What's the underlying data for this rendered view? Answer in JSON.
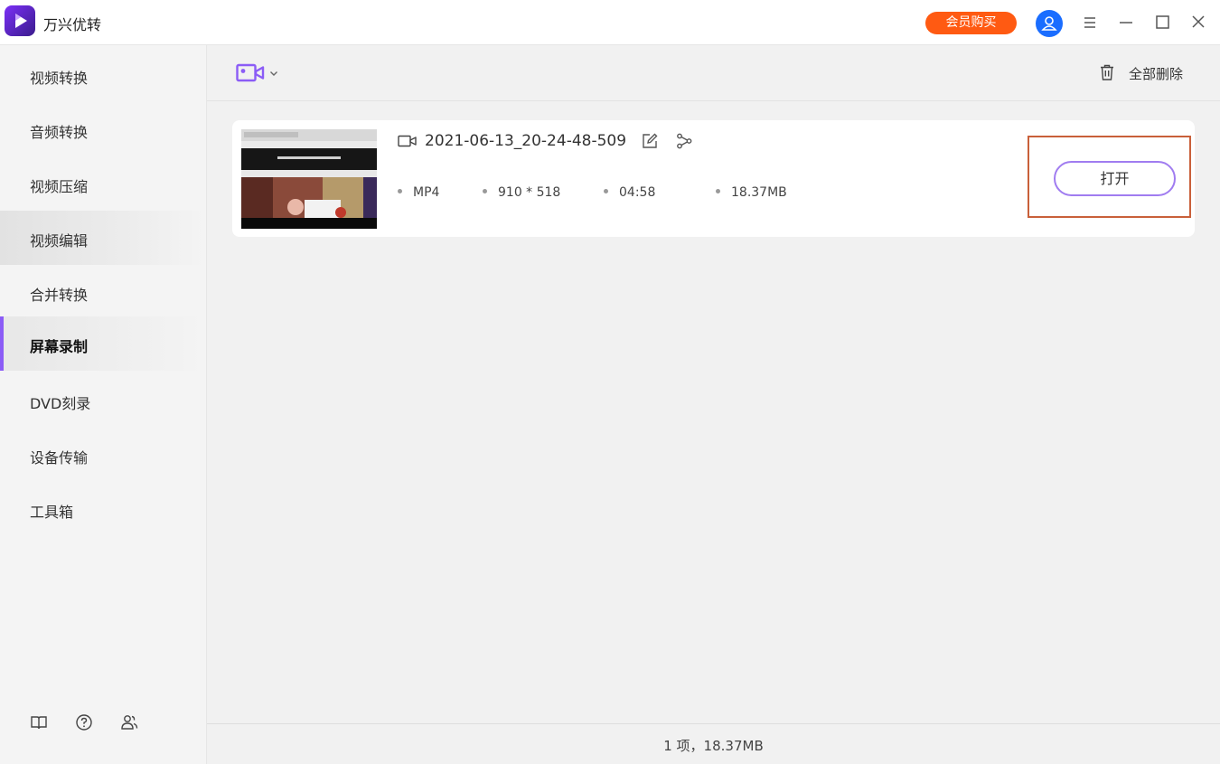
{
  "app": {
    "title": "万兴优转",
    "vip_label": "会员购买",
    "icons": {
      "logo": "app-logo-play-icon",
      "avatar": "user-avatar-icon",
      "menu": "hamburger-menu-icon",
      "minimize": "minimize-icon",
      "maximize": "maximize-icon",
      "close": "close-icon"
    },
    "colors": {
      "vip": "#ff5a12",
      "avatar": "#1a6dff",
      "accent": "#8b5cf6"
    }
  },
  "sidebar": {
    "items": [
      {
        "label": "视频转换",
        "state": "normal"
      },
      {
        "label": "音频转换",
        "state": "normal"
      },
      {
        "label": "视频压缩",
        "state": "normal"
      },
      {
        "label": "视频编辑",
        "state": "hover"
      },
      {
        "label": "合并转换",
        "state": "normal"
      },
      {
        "label": "屏幕录制",
        "state": "active"
      },
      {
        "label": "DVD刻录",
        "state": "normal"
      },
      {
        "label": "设备传输",
        "state": "normal"
      },
      {
        "label": "工具箱",
        "state": "normal"
      }
    ],
    "bottom_icons": [
      "book-guide-icon",
      "help-icon",
      "community-icon"
    ]
  },
  "toolbar": {
    "record_icon": "screen-record-icon",
    "delete_all_label": "全部删除",
    "delete_icon": "trash-icon"
  },
  "file": {
    "name": "2021-06-13_20-24-48-509",
    "format": "MP4",
    "resolution": "910 * 518",
    "duration": "04:58",
    "size": "18.37MB",
    "open_label": "打开",
    "icons": [
      "video-file-icon",
      "edit-icon",
      "share-icon"
    ]
  },
  "status": {
    "summary": "1 项，18.37MB"
  }
}
